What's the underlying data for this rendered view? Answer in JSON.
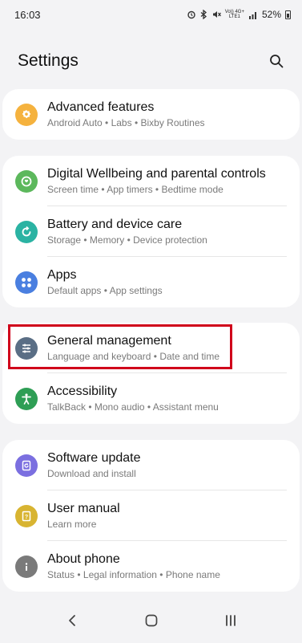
{
  "status": {
    "time": "16:03",
    "signal_label_top": "Vo)) 4G+",
    "signal_label_bottom": "LTE1",
    "battery": "52%"
  },
  "header": {
    "title": "Settings",
    "search_icon": "search-icon"
  },
  "groups": [
    {
      "items": [
        {
          "title": "Advanced features",
          "subtitle": "Android Auto  •  Labs  •  Bixby Routines",
          "icon": "advanced-features-icon",
          "color": "#f5b23e"
        }
      ]
    },
    {
      "items": [
        {
          "title": "Digital Wellbeing and parental controls",
          "subtitle": "Screen time  •  App timers  •  Bedtime mode",
          "icon": "digital-wellbeing-icon",
          "color": "#5cb85c"
        },
        {
          "title": "Battery and device care",
          "subtitle": "Storage  •  Memory  •  Device protection",
          "icon": "device-care-icon",
          "color": "#2bb3a3"
        },
        {
          "title": "Apps",
          "subtitle": "Default apps  •  App settings",
          "icon": "apps-icon",
          "color": "#4a7fe0"
        }
      ]
    },
    {
      "items": [
        {
          "title": "General management",
          "subtitle": "Language and keyboard  •  Date and time",
          "icon": "general-management-icon",
          "color": "#5a6e85"
        },
        {
          "title": "Accessibility",
          "subtitle": "TalkBack  •  Mono audio  •  Assistant menu",
          "icon": "accessibility-icon",
          "color": "#2e9e55"
        }
      ]
    },
    {
      "items": [
        {
          "title": "Software update",
          "subtitle": "Download and install",
          "icon": "software-update-icon",
          "color": "#7b6fe0"
        },
        {
          "title": "User manual",
          "subtitle": "Learn more",
          "icon": "user-manual-icon",
          "color": "#d8b431"
        },
        {
          "title": "About phone",
          "subtitle": "Status  •  Legal information  •  Phone name",
          "icon": "about-phone-icon",
          "color": "#7a7a7a"
        }
      ]
    }
  ],
  "navbar": {
    "back_icon": "back-icon",
    "home_icon": "home-icon",
    "recents_icon": "recents-icon"
  }
}
